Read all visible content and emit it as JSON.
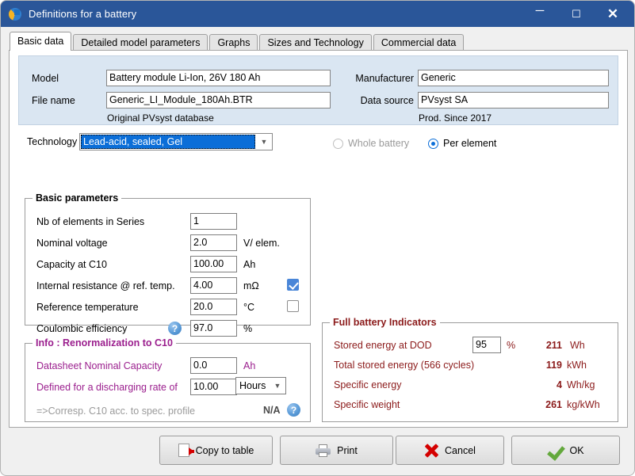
{
  "window": {
    "title": "Definitions for a battery",
    "icon": "pvsyst-logo-icon",
    "minimize_label": "─",
    "maximize_label": "☐",
    "close_label": "✕",
    "titlebar_color": "#2a5699"
  },
  "tabs": [
    {
      "label": "Basic data",
      "active": true
    },
    {
      "label": "Detailed model parameters",
      "active": false
    },
    {
      "label": "Graphs",
      "active": false
    },
    {
      "label": "Sizes and Technology",
      "active": false
    },
    {
      "label": "Commercial data",
      "active": false
    }
  ],
  "header": {
    "model_label": "Model",
    "model_value": "Battery module Li-Ion, 26V 180 Ah",
    "filename_label": "File name",
    "filename_value": "Generic_LI_Module_180Ah.BTR",
    "database_note": "Original PVsyst database",
    "manufacturer_label": "Manufacturer",
    "manufacturer_value": "Generic",
    "datasource_label": "Data source",
    "datasource_value": "PVsyst SA",
    "production_note": "Prod. Since 2017"
  },
  "technology": {
    "label": "Technology",
    "selected": "Lead-acid, sealed, Gel",
    "highlight_color": "#0b6ed8"
  },
  "scope": {
    "whole_battery_label": "Whole battery",
    "whole_battery_selected": false,
    "whole_battery_disabled": true,
    "per_element_label": "Per element",
    "per_element_selected": true
  },
  "basic_parameters": {
    "title": "Basic parameters",
    "rows": [
      {
        "label": "Nb of elements in Series",
        "value": "1",
        "unit": "",
        "checkbox": null
      },
      {
        "label": "Nominal voltage",
        "value": "2.0",
        "unit": "V/ elem.",
        "checkbox": null
      },
      {
        "label": "Capacity at C10",
        "value": "100.00",
        "unit": "Ah",
        "checkbox": null
      },
      {
        "label": "Internal resistance @ ref. temp.",
        "value": "4.00",
        "unit": "mΩ",
        "checkbox": true
      },
      {
        "label": "Reference temperature",
        "value": "20.0",
        "unit": "°C",
        "checkbox": false
      },
      {
        "label": "Coulombic efficiency",
        "value": "97.0",
        "unit": "%",
        "checkbox": null,
        "help": "?"
      }
    ]
  },
  "renormalization": {
    "title": "Info : Renormalization to C10",
    "label_color": "#9b1f8e",
    "datasheet_label": "Datasheet Nominal Capacity",
    "datasheet_value": "0.0",
    "datasheet_unit": "Ah",
    "rate_label": "Defined for a discharging rate of",
    "rate_value": "10.00",
    "rate_unit_selected": "Hours",
    "corresp_label": "=>Corresp. C10 acc. to spec. profile",
    "corresp_value": "N/A",
    "help": "?"
  },
  "full_battery_indicators": {
    "title": "Full battery Indicators",
    "label_color": "#8b1a1a",
    "dod_label": "Stored energy at DOD",
    "dod_value": "95",
    "dod_unit": "%",
    "dod_result": "211",
    "dod_result_unit": "Wh",
    "total_label": "Total stored energy (566 cycles)",
    "total_result": "119",
    "total_result_unit": "kWh",
    "spec_energy_label": "Specific energy",
    "spec_energy_result": "4",
    "spec_energy_unit": "Wh/kg",
    "spec_weight_label": "Specific weight",
    "spec_weight_result": "261",
    "spec_weight_unit": "kg/kWh"
  },
  "buttons": {
    "copy_to_table": "Copy to table",
    "print": "Print",
    "cancel": "Cancel",
    "ok": "OK"
  }
}
